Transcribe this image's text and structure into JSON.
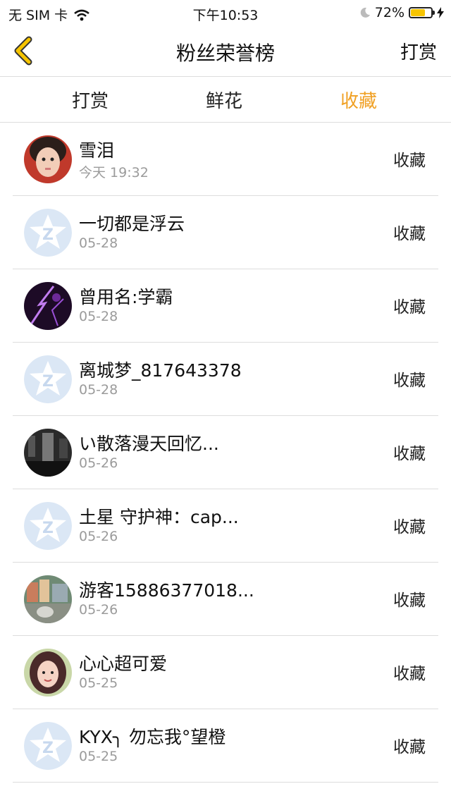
{
  "status_bar": {
    "carrier": "无 SIM 卡",
    "time": "下午10:53",
    "battery_percent": "72%",
    "battery_level": 0.72,
    "battery_color": "#f6c400"
  },
  "navbar": {
    "title": "粉丝荣誉榜",
    "right_label": "打赏"
  },
  "tabs": [
    {
      "label": "打赏",
      "active": false
    },
    {
      "label": "鲜花",
      "active": false
    },
    {
      "label": "收藏",
      "active": true
    }
  ],
  "accent_color": "#f0a023",
  "list": [
    {
      "name": "雪泪",
      "time": "今天 19:32",
      "action": "收藏",
      "avatar": "photo-girl"
    },
    {
      "name": "一切都是浮云",
      "time": "05-28",
      "action": "收藏",
      "avatar": "default-star"
    },
    {
      "name": "曾用名:学霸",
      "time": "05-28",
      "action": "收藏",
      "avatar": "photo-purple"
    },
    {
      "name": "离城梦_817643378",
      "time": "05-28",
      "action": "收藏",
      "avatar": "default-star"
    },
    {
      "name": "い散落漫天回忆...",
      "time": "05-26",
      "action": "收藏",
      "avatar": "photo-dark"
    },
    {
      "name": "土星 守护神：cap...",
      "time": "05-26",
      "action": "收藏",
      "avatar": "default-star"
    },
    {
      "name": "游客15886377018...",
      "time": "05-26",
      "action": "收藏",
      "avatar": "photo-town"
    },
    {
      "name": "心心超可爱",
      "time": "05-25",
      "action": "收藏",
      "avatar": "photo-girl2"
    },
    {
      "name": "KYX╮ 勿忘我°望橙",
      "time": "05-25",
      "action": "收藏",
      "avatar": "default-star"
    }
  ]
}
